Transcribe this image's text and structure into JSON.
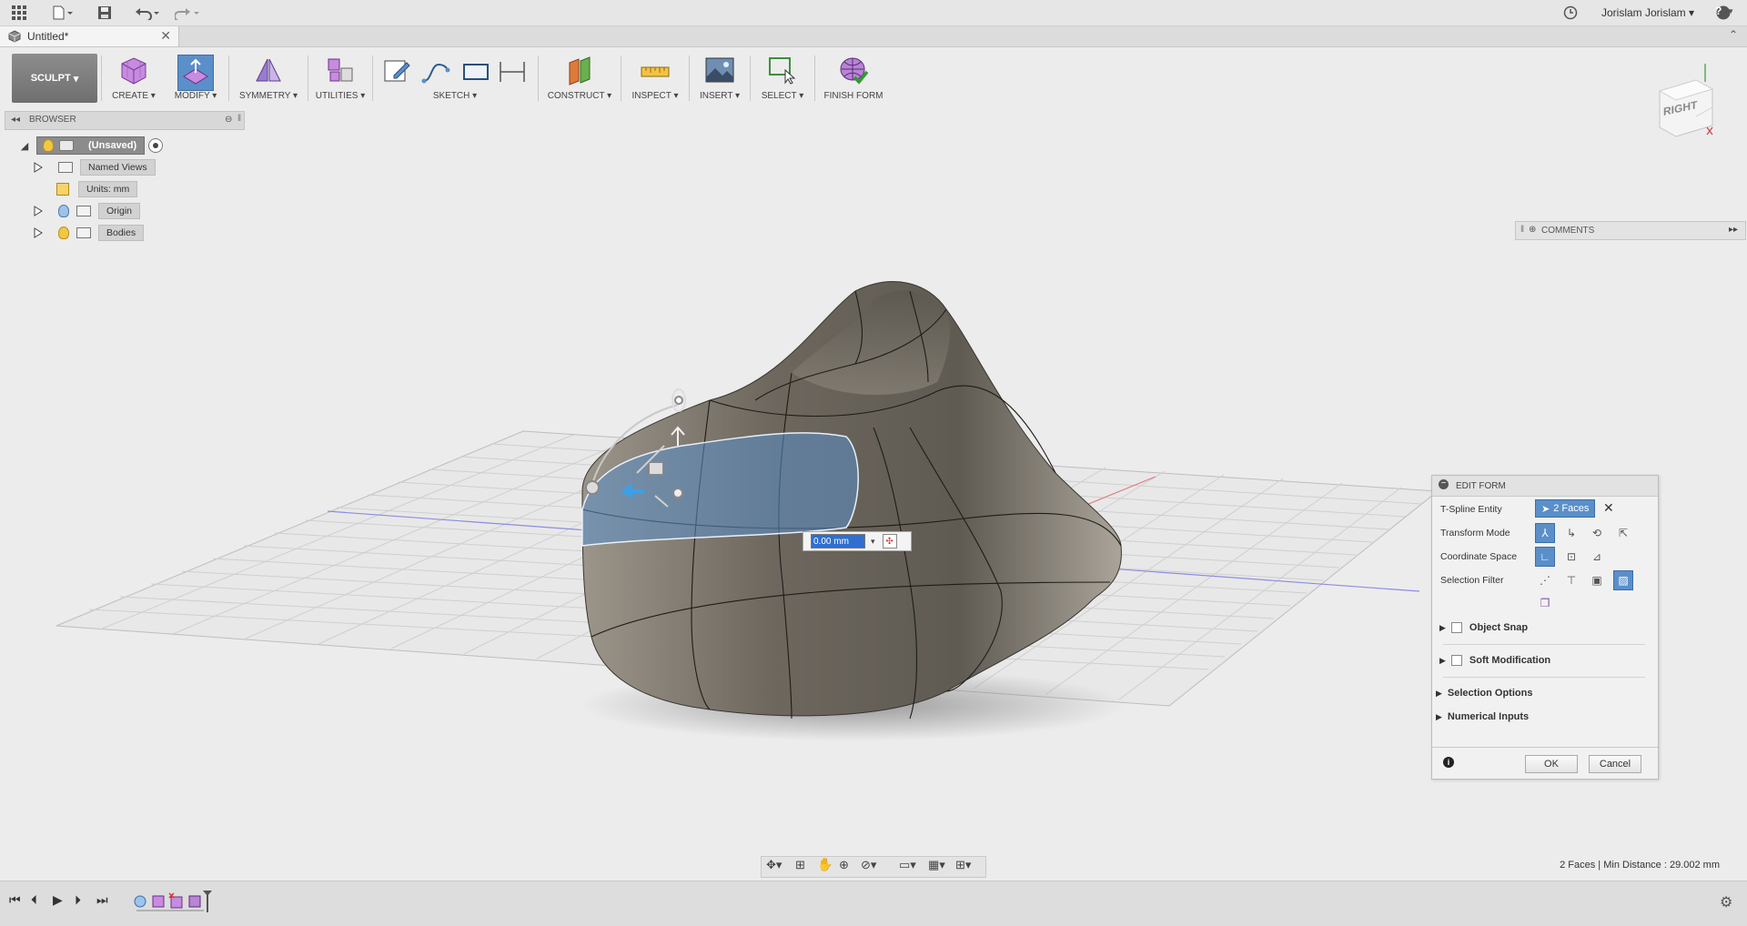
{
  "app": {
    "user_name": "Jorislam Jorislam",
    "help_label": "?"
  },
  "tab": {
    "title": "Untitled*"
  },
  "toolbar": {
    "workspace": "SCULPT",
    "groups": {
      "create": "CREATE",
      "modify": "MODIFY",
      "symmetry": "SYMMETRY",
      "utilities": "UTILITIES",
      "sketch": "SKETCH",
      "construct": "CONSTRUCT",
      "inspect": "INSPECT",
      "insert": "INSERT",
      "select": "SELECT",
      "finish_form": "FINISH FORM"
    }
  },
  "browser": {
    "title": "BROWSER",
    "root": "(Unsaved)",
    "items": [
      {
        "label": "Named Views"
      },
      {
        "label": "Units: mm"
      },
      {
        "label": "Origin"
      },
      {
        "label": "Bodies"
      }
    ]
  },
  "viewcube": {
    "face": "RIGHT"
  },
  "comments": {
    "title": "COMMENTS"
  },
  "viewport": {
    "distance_input": "0.00 mm"
  },
  "edit_form": {
    "title": "EDIT FORM",
    "tspline_entity_label": "T-Spline Entity",
    "tspline_entity_value": "2 Faces",
    "transform_mode_label": "Transform Mode",
    "coordinate_space_label": "Coordinate Space",
    "selection_filter_label": "Selection Filter",
    "object_snap": "Object Snap",
    "soft_modification": "Soft Modification",
    "selection_options": "Selection Options",
    "numerical_inputs": "Numerical Inputs",
    "ok": "OK",
    "cancel": "Cancel"
  },
  "status": {
    "text": "2 Faces | Min Distance : 29.002 mm"
  },
  "colors": {
    "selection_blue": "#5b8fc9",
    "body_grey": "#6d675e",
    "background": "#ececec"
  }
}
